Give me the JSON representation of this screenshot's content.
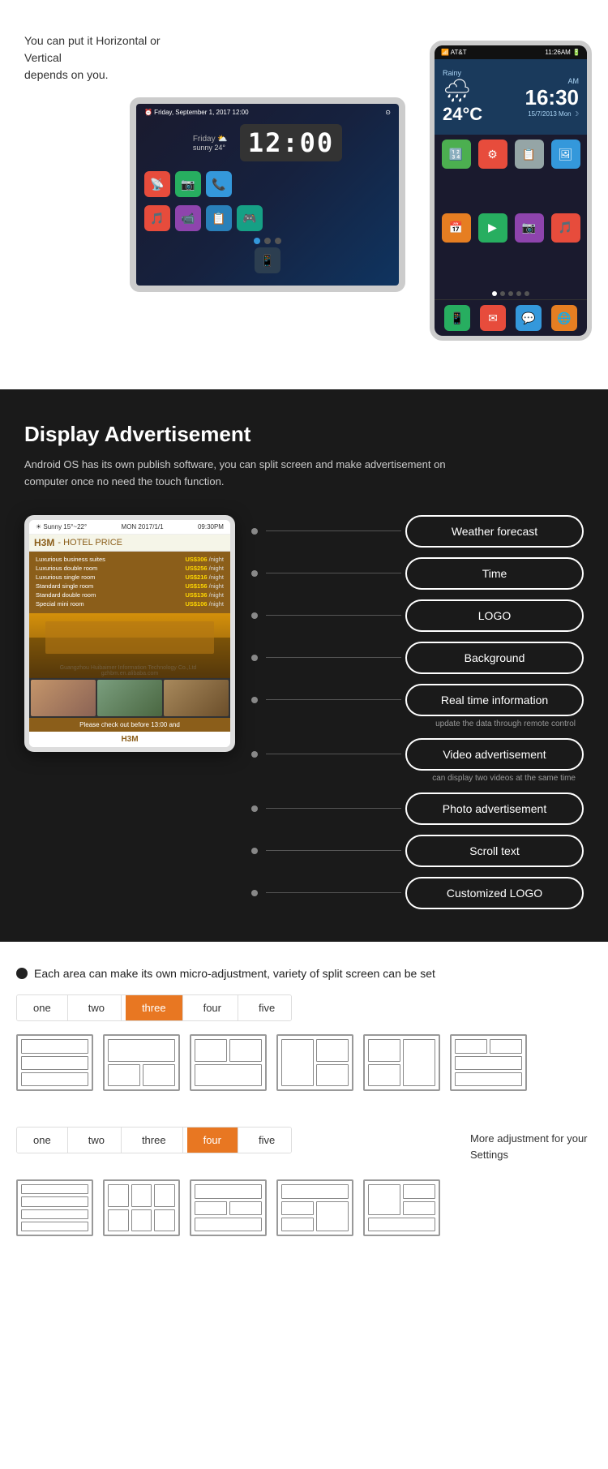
{
  "section1": {
    "description_line1": "You can put it Horizontal or Vertical",
    "description_line2": "depends on you.",
    "tablet": {
      "topbar_left": "⏰ Friday, September 1, 2017  12:00",
      "topbar_right": "⊙",
      "clock": "12:00",
      "date": "September 1, 2017",
      "weather": "Friday  ⛅  24°  sunny",
      "apps": [
        "📡",
        "📷",
        "📞",
        "🎵",
        "📹",
        "📋",
        "🎮"
      ]
    },
    "phone": {
      "topbar_left": "📶 AT&T",
      "topbar_right": "11:26AM 🔋",
      "condition": "Rainy",
      "temp": "24°C",
      "time_label": "AM",
      "time_big": "16:30",
      "date_bottom": "15/7/2013  Mon ☽",
      "apps_row1": [
        "🔢",
        "⚙",
        "📋",
        "🖼"
      ],
      "apps_row2": [
        "📅",
        "▶",
        "📷",
        "🎵"
      ],
      "apps_row3": [
        "📱",
        "✉",
        "💬",
        "🌐"
      ]
    }
  },
  "section2": {
    "title": "Display Advertisement",
    "description": "Android OS has its own publish software, you can split screen and make advertisement on computer once no need the touch function.",
    "hotel_screen": {
      "topbar_left": "Sunny  15°~22°",
      "topbar_date": "MON  2017/1/1",
      "topbar_time": "09:30PM",
      "brand": "H3M - HOTEL PRICE",
      "prices": [
        {
          "room": "Luxurious business suites",
          "price": "US$306",
          "unit": "/night"
        },
        {
          "room": "Luxurious double room",
          "price": "US$256",
          "unit": "/night"
        },
        {
          "room": "Luxurious single room",
          "price": "US$216",
          "unit": "/night"
        },
        {
          "room": "Standard single room",
          "price": "US$156",
          "unit": "/night"
        },
        {
          "room": "Standard double room",
          "price": "US$136",
          "unit": "/night"
        },
        {
          "room": "Special mini room",
          "price": "US$106",
          "unit": "/night"
        }
      ],
      "scroll_text": "Please check out  before 13:00 and",
      "logo_bottom": "H3M",
      "watermark": "Guangzhou Huibaimer Information Technology Co.,Ltd     gzhbm.en.alibaba.com"
    },
    "features": [
      {
        "label": "Weather forecast",
        "note": ""
      },
      {
        "label": "Time",
        "note": ""
      },
      {
        "label": "LOGO",
        "note": ""
      },
      {
        "label": "Background",
        "note": ""
      },
      {
        "label": "Real time information",
        "note": "update the data through remote control"
      },
      {
        "label": "Video advertisement",
        "note": "can display two videos at the same time"
      },
      {
        "label": "Photo advertisement",
        "note": ""
      },
      {
        "label": "Scroll text",
        "note": ""
      },
      {
        "label": "Customized LOGO",
        "note": ""
      }
    ]
  },
  "section3": {
    "header_text": "Each area can make its own micro-adjustment, variety of split screen can be set",
    "tabs_top": [
      "one",
      "two",
      "three",
      "four",
      "five"
    ],
    "active_tab_top": "three",
    "tabs_bottom": [
      "one",
      "two",
      "three",
      "four",
      "five"
    ],
    "active_tab_bottom": "four",
    "more_settings_text": "More adjustment for your Settings"
  }
}
